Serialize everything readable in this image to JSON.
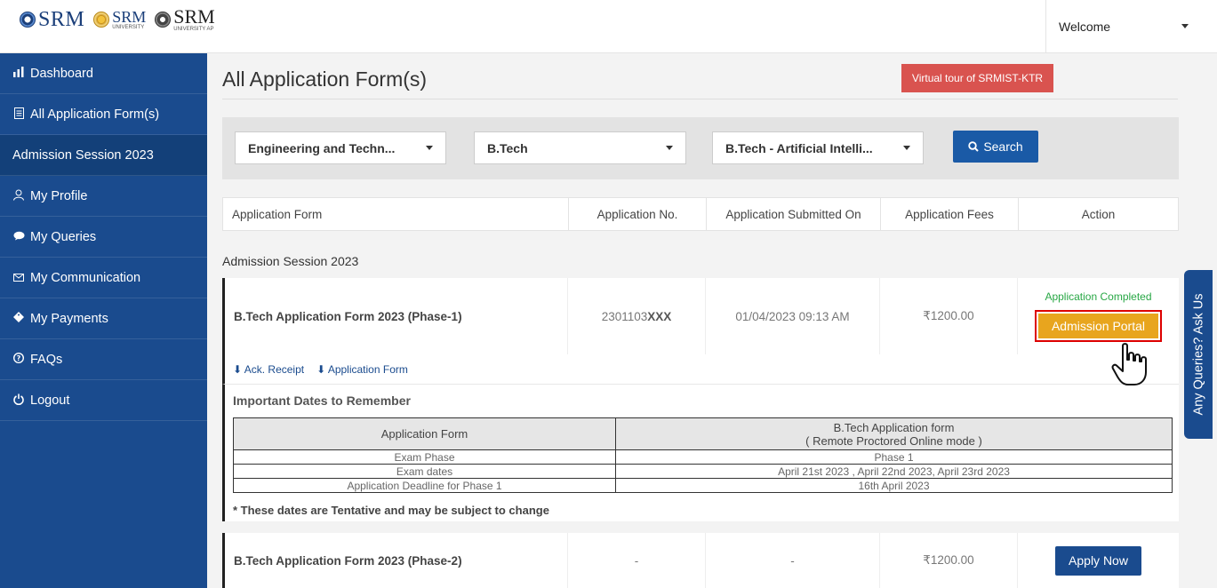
{
  "header": {
    "logos": [
      {
        "name": "SRM"
      },
      {
        "name": "SRM",
        "sub": "UNIVERSITY"
      },
      {
        "name": "SRM",
        "sub": "UNIVERSITY AP"
      }
    ],
    "user_menu_label": "Welcome"
  },
  "sidebar": {
    "items": [
      {
        "label": "Dashboard",
        "icon": "bar-chart-icon"
      },
      {
        "label": "All Application Form(s)",
        "icon": "document-icon"
      },
      {
        "label": "Admission Session 2023",
        "icon": ""
      },
      {
        "label": "My Profile",
        "icon": "user-icon"
      },
      {
        "label": "My Queries",
        "icon": "chat-icon"
      },
      {
        "label": "My Communication",
        "icon": "mail-icon"
      },
      {
        "label": "My Payments",
        "icon": "tag-icon"
      },
      {
        "label": "FAQs",
        "icon": "help-icon"
      },
      {
        "label": "Logout",
        "icon": "power-icon"
      }
    ]
  },
  "main": {
    "title": "All Application Form(s)",
    "tour_button": "Virtual tour of SRMIST-KTR",
    "filters": {
      "faculty": "Engineering and Techn...",
      "program": "B.Tech",
      "specialization": "B.Tech - Artificial Intelli...",
      "search_label": "Search"
    },
    "table": {
      "columns": [
        "Application Form",
        "Application No.",
        "Application Submitted On",
        "Application Fees",
        "Action"
      ],
      "session_label": "Admission Session 2023",
      "rows": [
        {
          "form": "B.Tech Application Form 2023 (Phase-1)",
          "app_no_prefix": "2301103",
          "app_no_masked": "XXX",
          "submitted_on": "01/04/2023 09:13 AM",
          "fees": "₹1200.00",
          "status": "Application Completed",
          "action": "Admission Portal",
          "links": [
            "Ack. Receipt",
            "Application Form"
          ]
        },
        {
          "form": "B.Tech Application Form 2023 (Phase-2)",
          "app_no": "-",
          "submitted_on": "-",
          "fees": "₹1200.00",
          "action": "Apply Now"
        }
      ]
    },
    "important_dates": {
      "title": "Important Dates to Remember",
      "header_left": "Application Form",
      "header_right_line1": "B.Tech Application form",
      "header_right_line2": "( Remote Proctored Online mode )",
      "rows": [
        {
          "label": "Exam Phase",
          "value": "Phase 1"
        },
        {
          "label": "Exam dates",
          "value": "April 21st 2023 , April 22nd 2023, April 23rd 2023"
        },
        {
          "label": "Application Deadline for Phase 1",
          "value": "16th April 2023"
        }
      ],
      "note": "* These dates are Tentative and may be subject to change"
    },
    "side_tab": "Any Queries? Ask Us"
  }
}
